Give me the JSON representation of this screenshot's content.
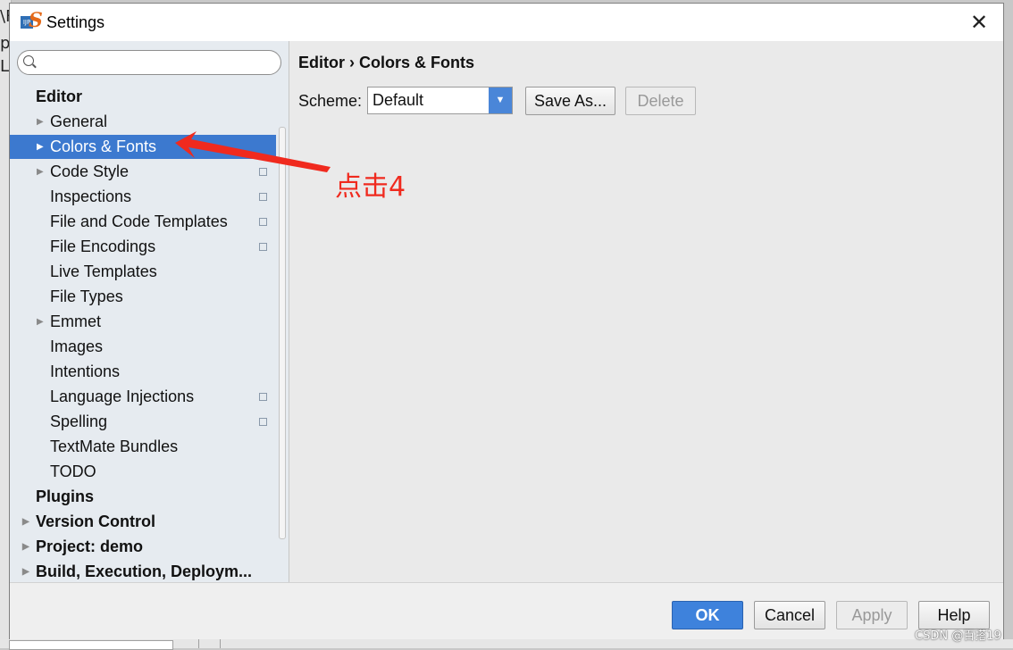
{
  "background": {
    "chars": [
      "\\F",
      "p",
      "Li"
    ]
  },
  "window": {
    "title": "Settings",
    "close_glyph": "✕",
    "icon_text": "IJP"
  },
  "sidebar": {
    "search_placeholder": "",
    "items": [
      {
        "label": "Editor",
        "level": 0,
        "bold": true,
        "arrow": false,
        "copy": false,
        "selected": false
      },
      {
        "label": "General",
        "level": 1,
        "bold": false,
        "arrow": true,
        "copy": false,
        "selected": false
      },
      {
        "label": "Colors & Fonts",
        "level": 1,
        "bold": false,
        "arrow": true,
        "copy": false,
        "selected": true
      },
      {
        "label": "Code Style",
        "level": 1,
        "bold": false,
        "arrow": true,
        "copy": true,
        "selected": false
      },
      {
        "label": "Inspections",
        "level": 1,
        "bold": false,
        "arrow": false,
        "copy": true,
        "selected": false
      },
      {
        "label": "File and Code Templates",
        "level": 1,
        "bold": false,
        "arrow": false,
        "copy": true,
        "selected": false
      },
      {
        "label": "File Encodings",
        "level": 1,
        "bold": false,
        "arrow": false,
        "copy": true,
        "selected": false
      },
      {
        "label": "Live Templates",
        "level": 1,
        "bold": false,
        "arrow": false,
        "copy": false,
        "selected": false
      },
      {
        "label": "File Types",
        "level": 1,
        "bold": false,
        "arrow": false,
        "copy": false,
        "selected": false
      },
      {
        "label": "Emmet",
        "level": 1,
        "bold": false,
        "arrow": true,
        "copy": false,
        "selected": false
      },
      {
        "label": "Images",
        "level": 1,
        "bold": false,
        "arrow": false,
        "copy": false,
        "selected": false
      },
      {
        "label": "Intentions",
        "level": 1,
        "bold": false,
        "arrow": false,
        "copy": false,
        "selected": false
      },
      {
        "label": "Language Injections",
        "level": 1,
        "bold": false,
        "arrow": false,
        "copy": true,
        "selected": false
      },
      {
        "label": "Spelling",
        "level": 1,
        "bold": false,
        "arrow": false,
        "copy": true,
        "selected": false
      },
      {
        "label": "TextMate Bundles",
        "level": 1,
        "bold": false,
        "arrow": false,
        "copy": false,
        "selected": false
      },
      {
        "label": "TODO",
        "level": 1,
        "bold": false,
        "arrow": false,
        "copy": false,
        "selected": false
      },
      {
        "label": "Plugins",
        "level": 0,
        "bold": true,
        "arrow": false,
        "copy": false,
        "selected": false
      },
      {
        "label": "Version Control",
        "level": 0,
        "bold": true,
        "arrow": true,
        "copy": false,
        "selected": false
      },
      {
        "label": "Project: demo",
        "level": 0,
        "bold": true,
        "arrow": true,
        "copy": false,
        "selected": false
      },
      {
        "label": "Build, Execution, Deploym...",
        "level": 0,
        "bold": true,
        "arrow": true,
        "copy": false,
        "selected": false
      }
    ]
  },
  "main": {
    "breadcrumb": "Editor › Colors & Fonts",
    "scheme_label": "Scheme:",
    "scheme_value": "Default",
    "save_as_label": "Save As...",
    "delete_label": "Delete"
  },
  "footer": {
    "ok_label": "OK",
    "cancel_label": "Cancel",
    "apply_label": "Apply",
    "help_label": "Help"
  },
  "annotation": {
    "text": "点击4",
    "color": "#f02a1e"
  },
  "watermark": "CSDN @百搭19",
  "colors": {
    "selection": "#3c79cf",
    "ok_button": "#3e82dc",
    "sidebar_bg": "#e6ebf0"
  }
}
